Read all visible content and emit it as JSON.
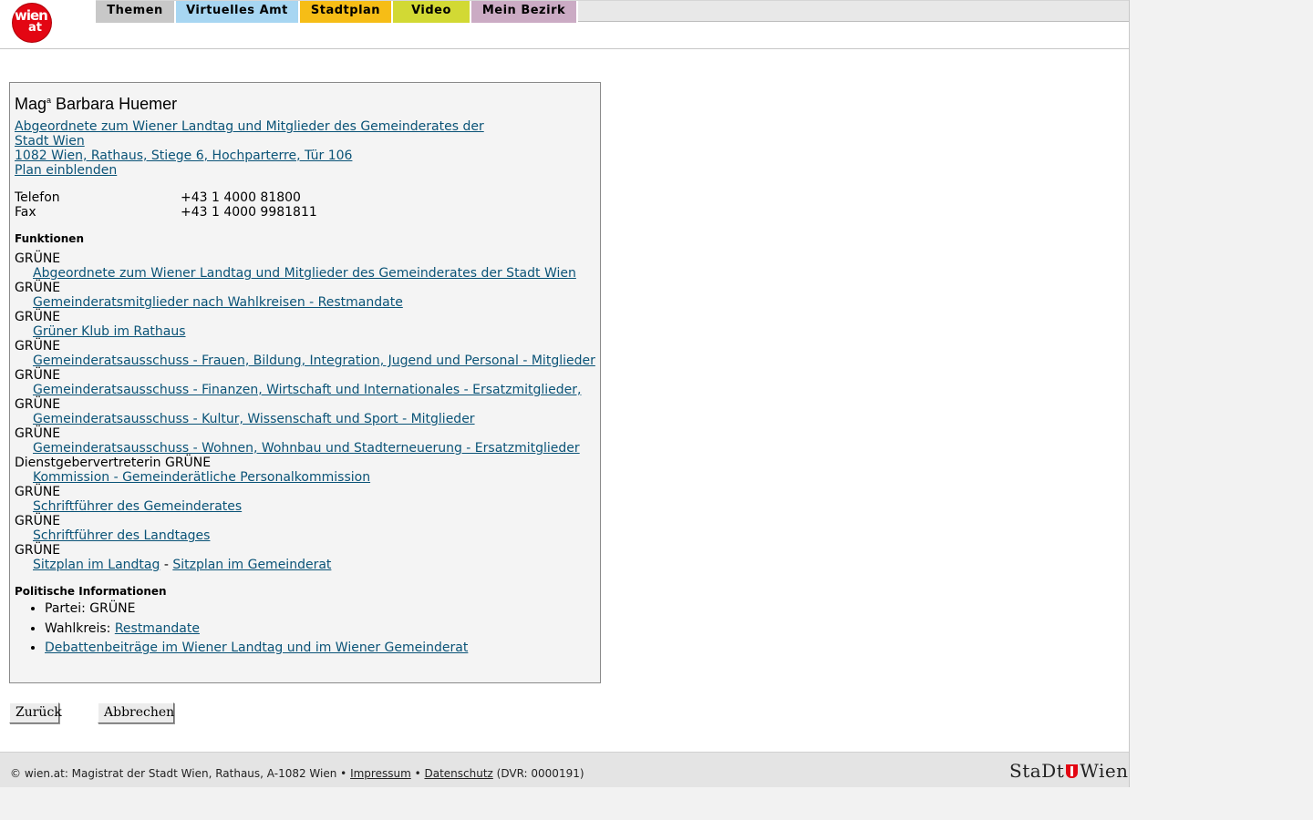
{
  "header": {
    "logo_text_top": "wien",
    "logo_text_bottom": "at",
    "tabs": [
      {
        "label": "Themen",
        "color": "#c8c8c8"
      },
      {
        "label": "Virtuelles Amt",
        "color": "#a7d6f2"
      },
      {
        "label": "Stadtplan",
        "color": "#f6bd16"
      },
      {
        "label": "Video",
        "color": "#d2d934"
      },
      {
        "label": "Mein Bezirk",
        "color": "#cbabc4"
      }
    ]
  },
  "profile": {
    "name_prefix": "Mag",
    "name_sup": "a",
    "name": "Barbara Huemer",
    "role_link_line1": "Abgeordnete zum Wiener Landtag und Mitglieder des Gemeinderates der",
    "role_link_line2": "Stadt Wien ",
    "address_link": "1082 Wien, Rathaus, Stiege 6, Hochparterre, Tür 106",
    "plan_link": "Plan einblenden",
    "phone_label": "Telefon",
    "phone_value": "+43 1 4000 81800",
    "fax_label": "Fax",
    "fax_value": "+43 1 4000 9981811"
  },
  "functions": {
    "heading": "Funktionen",
    "items": [
      {
        "role": "GRÜNE",
        "link": "Abgeordnete zum Wiener Landtag und Mitglieder des Gemeinderates der Stadt Wien"
      },
      {
        "role": "GRÜNE",
        "link": "Gemeinderatsmitglieder nach Wahlkreisen - Restmandate"
      },
      {
        "role": "GRÜNE",
        "link": "Grüner Klub im Rathaus"
      },
      {
        "role": "GRÜNE",
        "link": "Gemeinderatsausschuss - Frauen, Bildung, Integration, Jugend und Personal - Mitglieder"
      },
      {
        "role": "GRÜNE",
        "link": "Gemeinderatsausschuss - Finanzen, Wirtschaft und Internationales - Ersatzmitglieder, "
      },
      {
        "role": "GRÜNE",
        "link": "Gemeinderatsausschuss - Kultur, Wissenschaft und Sport - Mitglieder"
      },
      {
        "role": "GRÜNE",
        "link": "Gemeinderatsausschuss - Wohnen, Wohnbau und Stadterneuerung - Ersatzmitglieder"
      },
      {
        "role": "Dienstgebervertreterin GRÜNE",
        "link": "Kommission - Gemeinderätliche Personalkommission"
      },
      {
        "role": "GRÜNE",
        "link": "Schriftführer des Gemeinderates"
      },
      {
        "role": "GRÜNE",
        "link": "Schriftführer des Landtages"
      },
      {
        "role": "GRÜNE",
        "link": "Sitzplan im Landtag",
        "separator": " - ",
        "link2": "Sitzplan im Gemeinderat"
      }
    ]
  },
  "political": {
    "heading": "Politische Informationen",
    "party_label": "Partei: GRÜNE",
    "district_label": "Wahlkreis: ",
    "district_link": "Restmandate",
    "debates_link": "Debattenbeiträge im Wiener Landtag und im Wiener Gemeinderat"
  },
  "buttons": {
    "back": "Zurück",
    "cancel": "Abbrechen"
  },
  "footer": {
    "text_prefix": "© wien.at: Magistrat der Stadt Wien, Rathaus, A-1082 Wien • ",
    "impressum": "Impressum",
    "bullet": " • ",
    "datenschutz": "Datenschutz",
    "text_suffix": " (DVR: 0000191)",
    "logo_left": "StaDt",
    "logo_right": "Wien"
  }
}
